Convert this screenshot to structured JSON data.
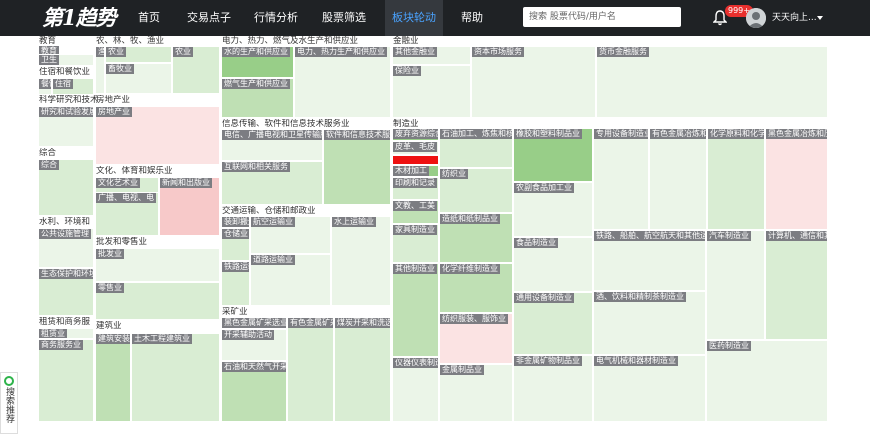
{
  "app": {
    "logo": "第1趋势"
  },
  "nav": {
    "items": [
      {
        "label": "首页",
        "active": false
      },
      {
        "label": "交易点子",
        "active": false
      },
      {
        "label": "行情分析",
        "active": false
      },
      {
        "label": "股票筛选",
        "active": false
      },
      {
        "label": "板块轮动",
        "active": true
      },
      {
        "label": "帮助",
        "active": false
      }
    ]
  },
  "search": {
    "placeholder": "搜索 股票代码/用户名"
  },
  "notifications": {
    "count": "999+"
  },
  "user": {
    "name": "天天向上..."
  },
  "side_widget": {
    "label": "搜索推荐"
  },
  "treemap": {
    "sectors": [
      {
        "title": "教育"
      },
      {
        "title": "住宿和餐饮业"
      },
      {
        "title": "科学研究和技术"
      },
      {
        "title": "综合"
      },
      {
        "title": "水利、环境和"
      },
      {
        "title": "租赁和商务服"
      },
      {
        "title": "农、林、牧、渔业"
      },
      {
        "title": "房地产业"
      },
      {
        "title": "文化、体育和娱乐业"
      },
      {
        "title": "批发和零售业"
      },
      {
        "title": "建筑业"
      },
      {
        "title": "电力、热力、燃气及水生产和供应业"
      },
      {
        "title": "信息传输、软件和信息技术服务业"
      },
      {
        "title": "交通运输、仓储和邮政业"
      },
      {
        "title": "采矿业"
      },
      {
        "title": "金融业"
      },
      {
        "title": "制造业"
      }
    ],
    "cells": [
      {
        "label": "教育"
      },
      {
        "label": "卫生"
      },
      {
        "label": "餐饮"
      },
      {
        "label": "住宿"
      },
      {
        "label": "研究和试验发展"
      },
      {
        "label": "综合"
      },
      {
        "label": "公共设施管理"
      },
      {
        "label": "生态保护和环境"
      },
      {
        "label": "租赁业"
      },
      {
        "label": "商务服务业"
      },
      {
        "label": "渔业"
      },
      {
        "label": "农业"
      },
      {
        "label": "畜牧业"
      },
      {
        "label": "房地产业"
      },
      {
        "label": "文化艺术业"
      },
      {
        "label": "新闻和出版业"
      },
      {
        "label": "广播、电视、电"
      },
      {
        "label": "批发业"
      },
      {
        "label": "零售业"
      },
      {
        "label": "建筑安装"
      },
      {
        "label": "土木工程建筑业"
      },
      {
        "label": "水的生产和供应业"
      },
      {
        "label": "电力、热力生产和供应业"
      },
      {
        "label": "电力、热力生产和供应业"
      },
      {
        "label": "燃气生产和供应业"
      },
      {
        "label": "电信、广播电视和卫星传输服务"
      },
      {
        "label": "软件和信息技术服务业"
      },
      {
        "label": "互联网和相关服务"
      },
      {
        "label": "装卸搬运"
      },
      {
        "label": "航空运输业"
      },
      {
        "label": "水上运输业"
      },
      {
        "label": "仓储业"
      },
      {
        "label": "道路运输业"
      },
      {
        "label": "铁路运输业"
      },
      {
        "label": "黑色金属矿采选业"
      },
      {
        "label": "开采辅助活动"
      },
      {
        "label": "有色金属矿采选业"
      },
      {
        "label": "煤炭开采和洗选业"
      },
      {
        "label": "石油和天然气开采业"
      },
      {
        "label": "其他金融业"
      },
      {
        "label": "资本市场服务"
      },
      {
        "label": "货币金融服务"
      },
      {
        "label": "保险业"
      },
      {
        "label": "废弃资源综合利用"
      },
      {
        "label": "皮革、毛皮"
      },
      {
        "label": "木材加工"
      },
      {
        "label": "印刷和记录"
      },
      {
        "label": "文教、工美"
      },
      {
        "label": "家具制造业"
      },
      {
        "label": "其他制造业"
      },
      {
        "label": "仪器仪表制造业"
      },
      {
        "label": "石油加工、炼焦和核燃料"
      },
      {
        "label": "纺织业"
      },
      {
        "label": "造纸和纸制品业"
      },
      {
        "label": "化学纤维制造业"
      },
      {
        "label": "纺织服装、服饰业"
      },
      {
        "label": "金属制品业"
      },
      {
        "label": "橡胶和塑料制品业"
      },
      {
        "label": "农副食品加工业"
      },
      {
        "label": "食品制造业"
      },
      {
        "label": "通用设备制造业"
      },
      {
        "label": "非金属矿物制品业"
      },
      {
        "label": "专用设备制造业"
      },
      {
        "label": "有色金属冶炼和压延"
      },
      {
        "label": "化学原料和化学制品"
      },
      {
        "label": "黑色金属冶炼和压延"
      },
      {
        "label": "铁路、船舶、航空航天和其他运输"
      },
      {
        "label": "汽车制造业"
      },
      {
        "label": "计算机、通信和其他电子设备"
      },
      {
        "label": "酒、饮料和精制茶制造业"
      },
      {
        "label": "电气机械和器材制造业"
      },
      {
        "label": "医药制造业"
      }
    ]
  },
  "colors": {
    "topbar": "#1f2225",
    "nav_active": "#4aa3ff",
    "label_bg": "#7c7d82",
    "up_red": "#ee1111",
    "down_green": "#98ce88"
  }
}
